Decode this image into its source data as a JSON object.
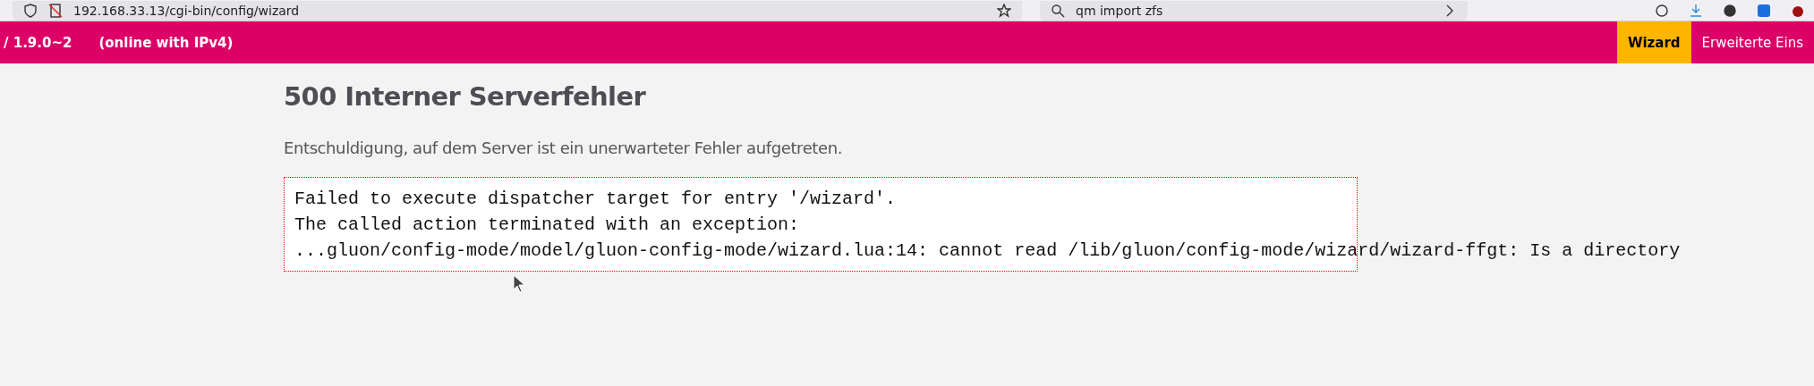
{
  "browser": {
    "address": "192.168.33.13/cgi-bin/config/wizard",
    "search": "qm import zfs"
  },
  "header": {
    "version": "/ 1.9.0~2",
    "status": "(online with IPv4)",
    "nav": [
      {
        "label": "Wizard",
        "selected": true
      },
      {
        "label": "Erweiterte Eins",
        "selected": false
      }
    ]
  },
  "error": {
    "title": "500 Interner Serverfehler",
    "message": "Entschuldigung, auf dem Server ist ein unerwarteter Fehler aufgetreten.",
    "details": [
      "Failed to execute dispatcher target for entry '/wizard'.",
      "The called action terminated with an exception:",
      "...gluon/config-mode/model/gluon-config-mode/wizard.lua:14: cannot read /lib/gluon/config-mode/wizard/wizard-ffgt: Is a directory"
    ]
  }
}
